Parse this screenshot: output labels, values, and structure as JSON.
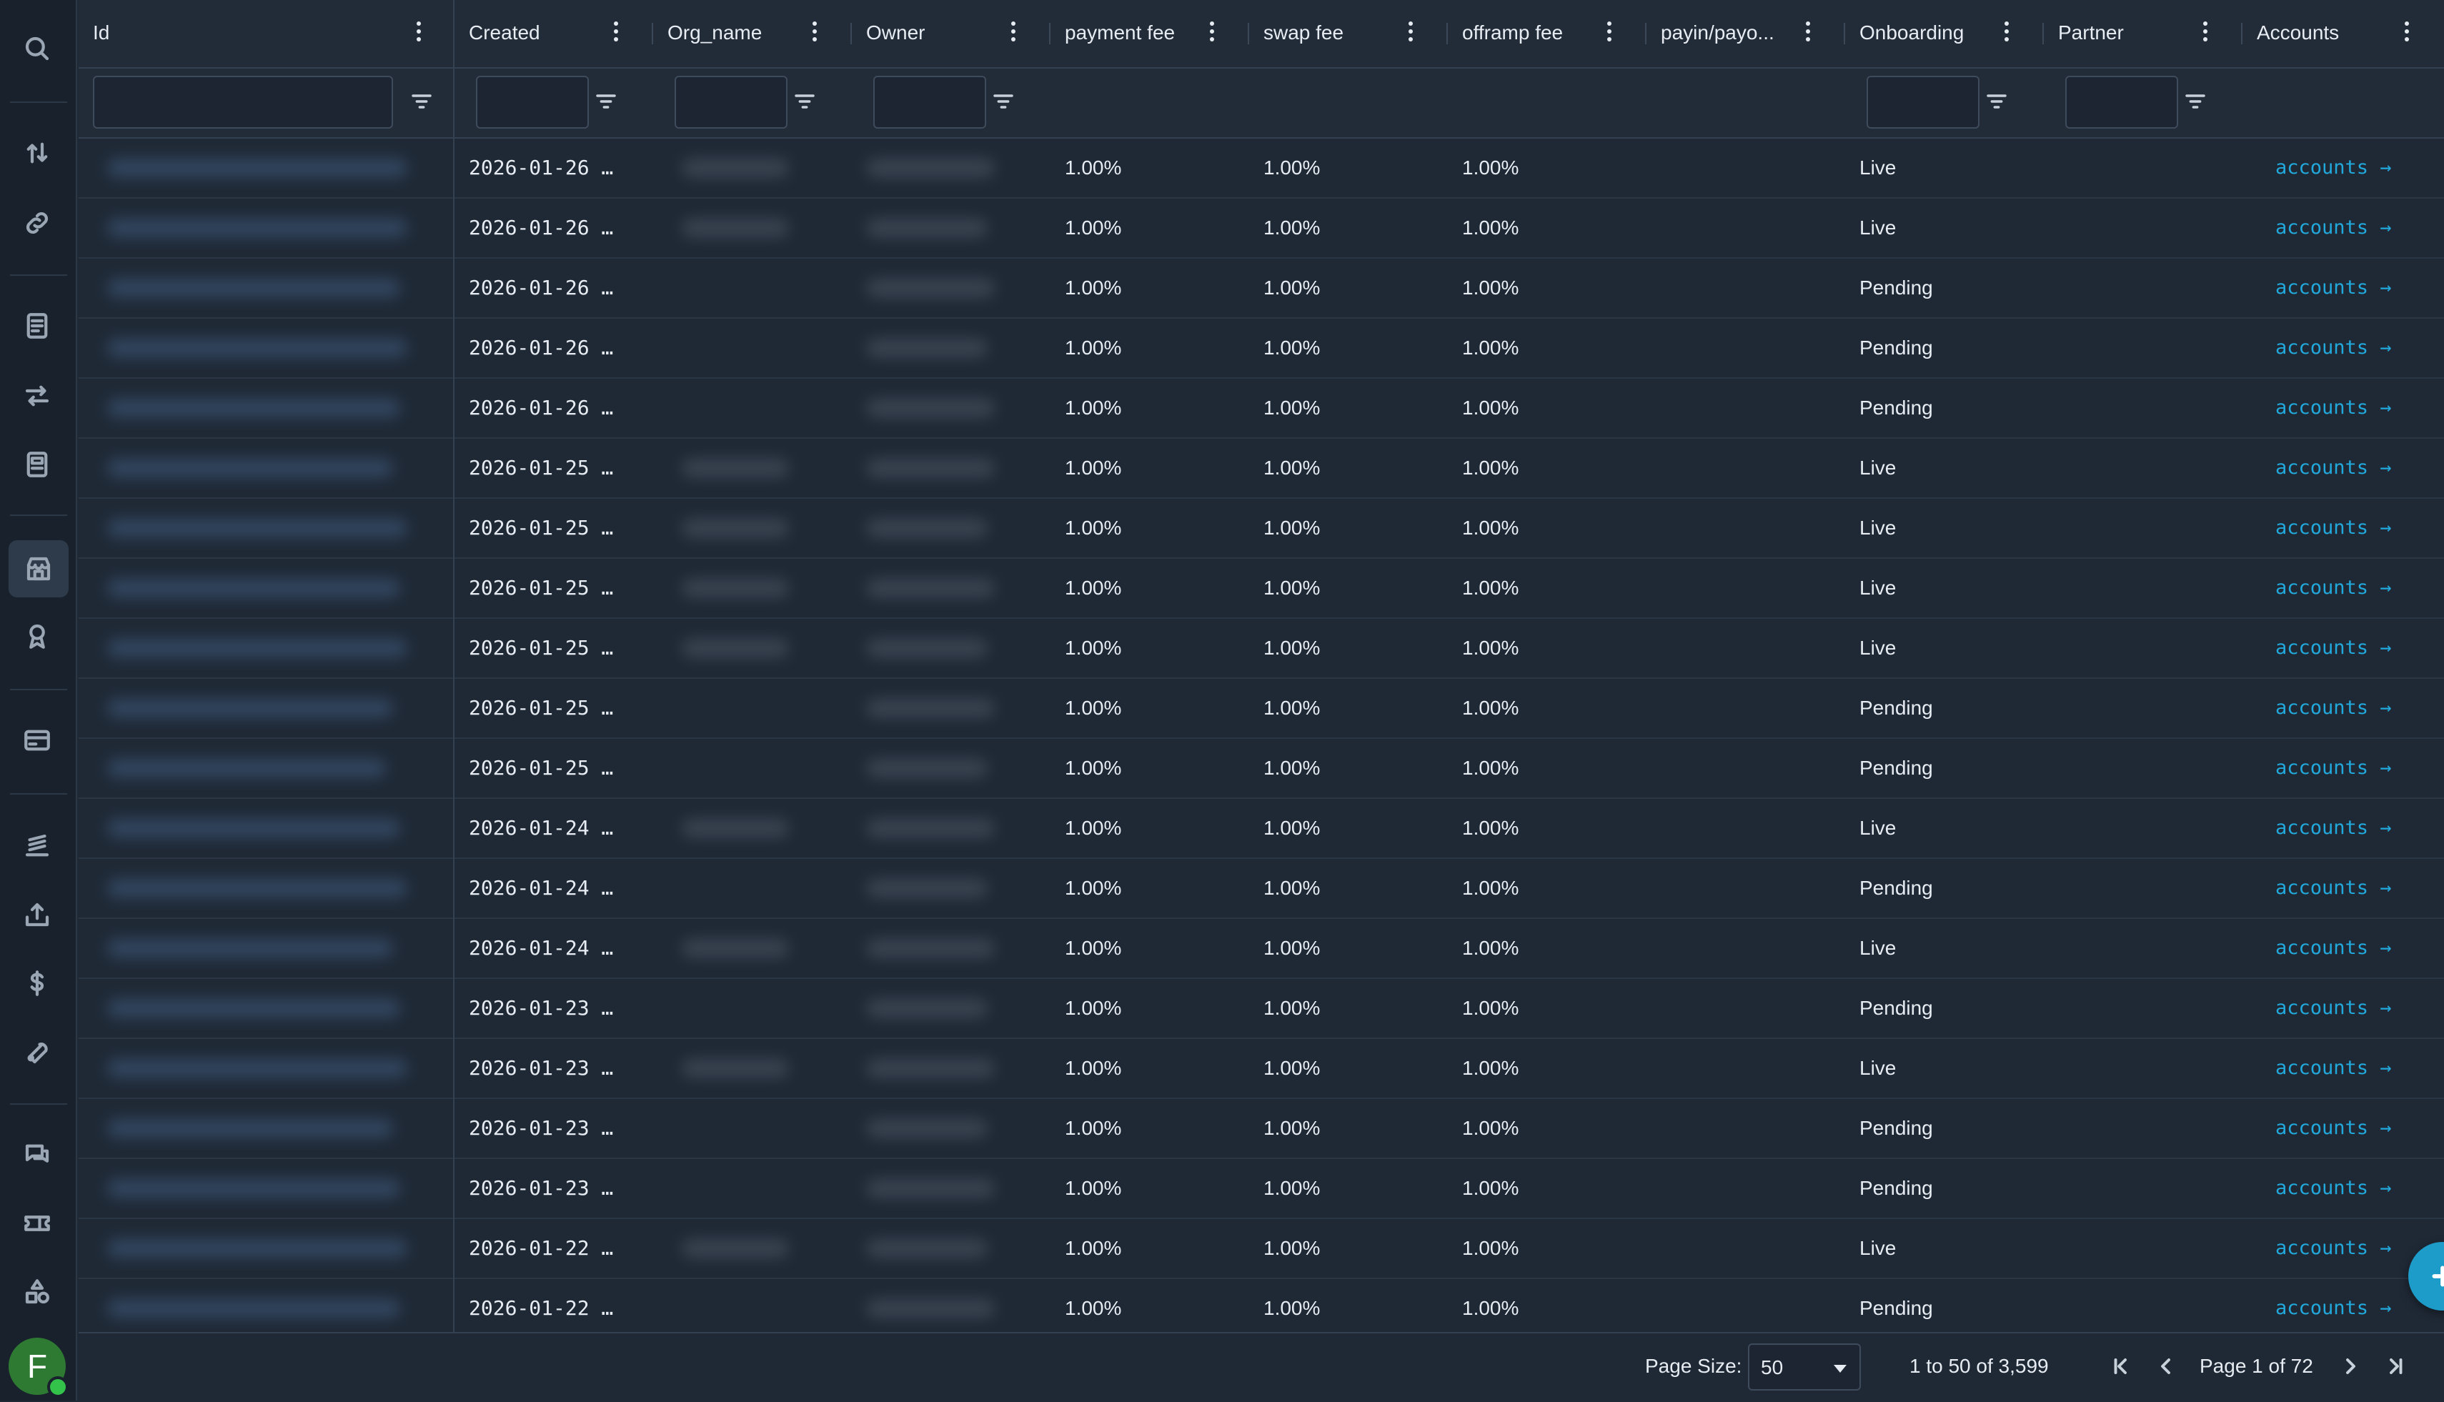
{
  "sidebar": {
    "icons": [
      "search-icon",
      "swap-vertical-icon",
      "link-icon",
      "receipt-icon",
      "transfer-icon",
      "document-icon",
      "store-icon",
      "badge-icon",
      "card-icon",
      "stack-icon",
      "upload-icon",
      "dollar-icon",
      "tools-icon",
      "chat-icon",
      "ticket-icon",
      "shapes-icon"
    ],
    "active": "store-icon",
    "avatar_letter": "F"
  },
  "columns": [
    {
      "key": "id",
      "label": "Id"
    },
    {
      "key": "created",
      "label": "Created"
    },
    {
      "key": "org_name",
      "label": "Org_name"
    },
    {
      "key": "owner",
      "label": "Owner"
    },
    {
      "key": "payment_fee",
      "label": "payment fee"
    },
    {
      "key": "swap_fee",
      "label": "swap fee"
    },
    {
      "key": "offramp_fee",
      "label": "offramp fee"
    },
    {
      "key": "payin_payout",
      "label": "payin/payo..."
    },
    {
      "key": "onboarding",
      "label": "Onboarding"
    },
    {
      "key": "partner",
      "label": "Partner"
    },
    {
      "key": "accounts",
      "label": "Accounts"
    }
  ],
  "rows": [
    {
      "created": "2026-01-26 …",
      "org_blurred": true,
      "payment_fee": "1.00%",
      "swap_fee": "1.00%",
      "offramp_fee": "1.00%",
      "onboarding": "Live",
      "accounts": "accounts →"
    },
    {
      "created": "2026-01-26 …",
      "org_blurred": true,
      "payment_fee": "1.00%",
      "swap_fee": "1.00%",
      "offramp_fee": "1.00%",
      "onboarding": "Live",
      "accounts": "accounts →"
    },
    {
      "created": "2026-01-26 …",
      "org_blurred": false,
      "payment_fee": "1.00%",
      "swap_fee": "1.00%",
      "offramp_fee": "1.00%",
      "onboarding": "Pending",
      "accounts": "accounts →"
    },
    {
      "created": "2026-01-26 …",
      "org_blurred": false,
      "payment_fee": "1.00%",
      "swap_fee": "1.00%",
      "offramp_fee": "1.00%",
      "onboarding": "Pending",
      "accounts": "accounts →"
    },
    {
      "created": "2026-01-26 …",
      "org_blurred": false,
      "payment_fee": "1.00%",
      "swap_fee": "1.00%",
      "offramp_fee": "1.00%",
      "onboarding": "Pending",
      "accounts": "accounts →"
    },
    {
      "created": "2026-01-25 …",
      "org_blurred": true,
      "payment_fee": "1.00%",
      "swap_fee": "1.00%",
      "offramp_fee": "1.00%",
      "onboarding": "Live",
      "accounts": "accounts →"
    },
    {
      "created": "2026-01-25 …",
      "org_blurred": true,
      "payment_fee": "1.00%",
      "swap_fee": "1.00%",
      "offramp_fee": "1.00%",
      "onboarding": "Live",
      "accounts": "accounts →"
    },
    {
      "created": "2026-01-25 …",
      "org_blurred": true,
      "payment_fee": "1.00%",
      "swap_fee": "1.00%",
      "offramp_fee": "1.00%",
      "onboarding": "Live",
      "accounts": "accounts →"
    },
    {
      "created": "2026-01-25 …",
      "org_blurred": true,
      "payment_fee": "1.00%",
      "swap_fee": "1.00%",
      "offramp_fee": "1.00%",
      "onboarding": "Live",
      "accounts": "accounts →"
    },
    {
      "created": "2026-01-25 …",
      "org_blurred": false,
      "payment_fee": "1.00%",
      "swap_fee": "1.00%",
      "offramp_fee": "1.00%",
      "onboarding": "Pending",
      "accounts": "accounts →"
    },
    {
      "created": "2026-01-25 …",
      "org_blurred": false,
      "payment_fee": "1.00%",
      "swap_fee": "1.00%",
      "offramp_fee": "1.00%",
      "onboarding": "Pending",
      "accounts": "accounts →"
    },
    {
      "created": "2026-01-24 …",
      "org_blurred": true,
      "payment_fee": "1.00%",
      "swap_fee": "1.00%",
      "offramp_fee": "1.00%",
      "onboarding": "Live",
      "accounts": "accounts →"
    },
    {
      "created": "2026-01-24 …",
      "org_blurred": false,
      "payment_fee": "1.00%",
      "swap_fee": "1.00%",
      "offramp_fee": "1.00%",
      "onboarding": "Pending",
      "accounts": "accounts →"
    },
    {
      "created": "2026-01-24 …",
      "org_blurred": true,
      "payment_fee": "1.00%",
      "swap_fee": "1.00%",
      "offramp_fee": "1.00%",
      "onboarding": "Live",
      "accounts": "accounts →"
    },
    {
      "created": "2026-01-23 …",
      "org_blurred": false,
      "payment_fee": "1.00%",
      "swap_fee": "1.00%",
      "offramp_fee": "1.00%",
      "onboarding": "Pending",
      "accounts": "accounts →"
    },
    {
      "created": "2026-01-23 …",
      "org_blurred": true,
      "payment_fee": "1.00%",
      "swap_fee": "1.00%",
      "offramp_fee": "1.00%",
      "onboarding": "Live",
      "accounts": "accounts →"
    },
    {
      "created": "2026-01-23 …",
      "org_blurred": false,
      "payment_fee": "1.00%",
      "swap_fee": "1.00%",
      "offramp_fee": "1.00%",
      "onboarding": "Pending",
      "accounts": "accounts →"
    },
    {
      "created": "2026-01-23 …",
      "org_blurred": false,
      "payment_fee": "1.00%",
      "swap_fee": "1.00%",
      "offramp_fee": "1.00%",
      "onboarding": "Pending",
      "accounts": "accounts →"
    },
    {
      "created": "2026-01-22 …",
      "org_blurred": true,
      "payment_fee": "1.00%",
      "swap_fee": "1.00%",
      "offramp_fee": "1.00%",
      "onboarding": "Live",
      "accounts": "accounts →"
    },
    {
      "created": "2026-01-22 …",
      "org_blurred": false,
      "payment_fee": "1.00%",
      "swap_fee": "1.00%",
      "offramp_fee": "1.00%",
      "onboarding": "Pending",
      "accounts": "accounts →"
    }
  ],
  "pagination": {
    "page_size_label": "Page Size:",
    "page_size_value": "50",
    "range_text": "1 to 50 of 3,599",
    "page_text": "Page 1 of 72"
  },
  "fab": {
    "icon": "plus-icon"
  },
  "colors": {
    "link": "#22a9dc",
    "fab": "#1d9bc9",
    "avatar": "#2f7a32",
    "background": "#1f2936"
  }
}
